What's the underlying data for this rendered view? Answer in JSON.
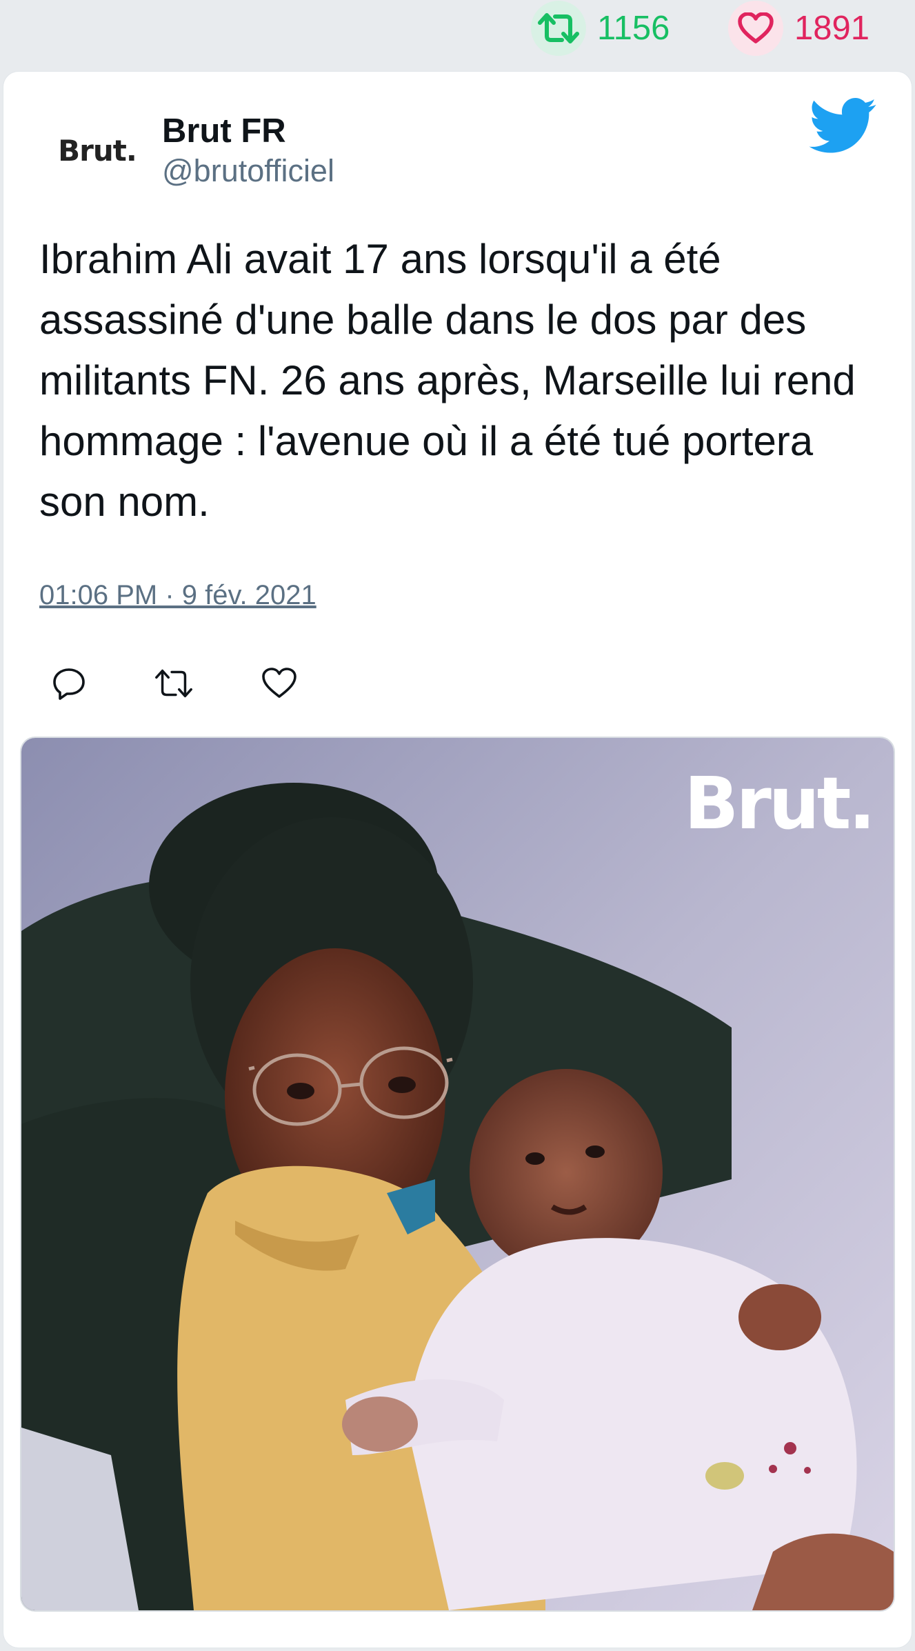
{
  "stats": {
    "retweets": "1156",
    "likes": "1891"
  },
  "tweet": {
    "avatar_logo": "Brut.",
    "author_name": "Brut FR",
    "author_handle": "@brutofficiel",
    "text": "Ibrahim Ali avait 17 ans lorsqu'il a été assassiné d'une balle dans le dos par des militants FN. 26 ans après, Marseille lui rend hommage : l'avenue où il a été tué portera son nom.",
    "timestamp": "01:06 PM · 9 fév. 2021",
    "media_watermark": "Brut."
  },
  "icons": {
    "retweet": "retweet-icon",
    "like": "heart-icon",
    "reply": "reply-icon",
    "brand": "twitter-bird-icon"
  },
  "colors": {
    "retweet_green": "#17bf63",
    "like_red": "#e0245e",
    "twitter_blue": "#1da1f2",
    "muted_text": "#5b7083"
  }
}
